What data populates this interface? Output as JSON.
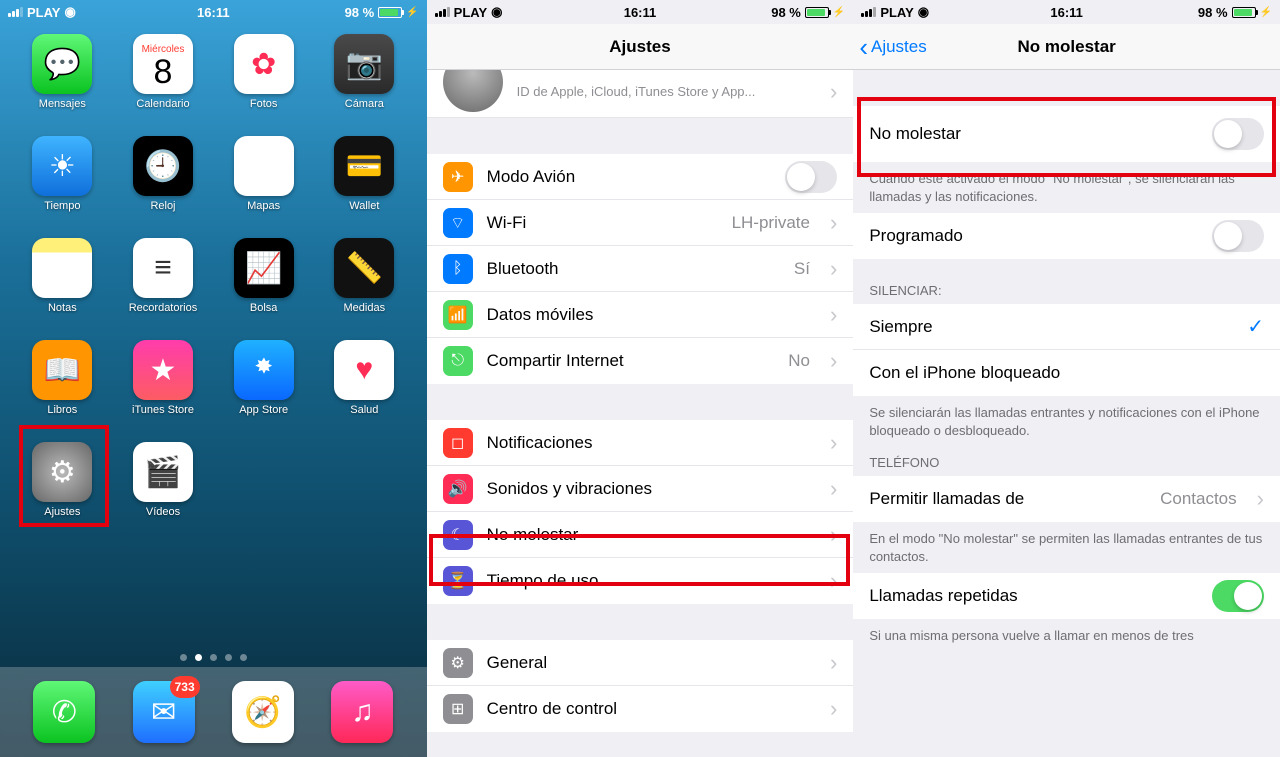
{
  "status": {
    "carrier": "PLAY",
    "time": "16:11",
    "battery": "98 %"
  },
  "home": {
    "calendar": {
      "dow": "Miércoles",
      "day": "8"
    },
    "apps": {
      "messages": "Mensajes",
      "calendar": "Calendario",
      "photos": "Fotos",
      "camera": "Cámara",
      "weather": "Tiempo",
      "clock": "Reloj",
      "maps": "Mapas",
      "wallet": "Wallet",
      "notes": "Notas",
      "reminders": "Recordatorios",
      "stocks": "Bolsa",
      "measure": "Medidas",
      "books": "Libros",
      "itunes": "iTunes Store",
      "appstore": "App Store",
      "health": "Salud",
      "settings": "Ajustes",
      "videos": "Vídeos"
    },
    "mail_badge": "733"
  },
  "s2": {
    "title": "Ajustes",
    "apple_id_sub": "ID de Apple, iCloud, iTunes Store y App...",
    "rows": {
      "airplane": "Modo Avión",
      "wifi": "Wi-Fi",
      "wifi_val": "LH-private",
      "bt": "Bluetooth",
      "bt_val": "Sí",
      "mobile": "Datos móviles",
      "hotspot": "Compartir Internet",
      "hotspot_val": "No",
      "notifications": "Notificaciones",
      "sounds": "Sonidos y vibraciones",
      "dnd": "No molestar",
      "screentime": "Tiempo de uso",
      "general": "General",
      "control": "Centro de control"
    }
  },
  "s3": {
    "back": "Ajustes",
    "title": "No molestar",
    "dnd": "No molestar",
    "dnd_footer": "Cuando esté activado el modo \"No molestar\", se silenciarán las llamadas y las notificaciones.",
    "scheduled": "Programado",
    "silence_header": "SILENCIAR:",
    "always": "Siempre",
    "while_locked": "Con el iPhone bloqueado",
    "silence_footer": "Se silenciarán las llamadas entrantes y notificaciones con el iPhone bloqueado o desbloqueado.",
    "phone_header": "TELÉFONO",
    "allow_calls": "Permitir llamadas de",
    "allow_calls_val": "Contactos",
    "allow_footer": "En el modo \"No molestar\" se permiten las llamadas entrantes de tus contactos.",
    "repeated": "Llamadas repetidas",
    "repeated_footer": "Si una misma persona vuelve a llamar en menos de tres"
  }
}
